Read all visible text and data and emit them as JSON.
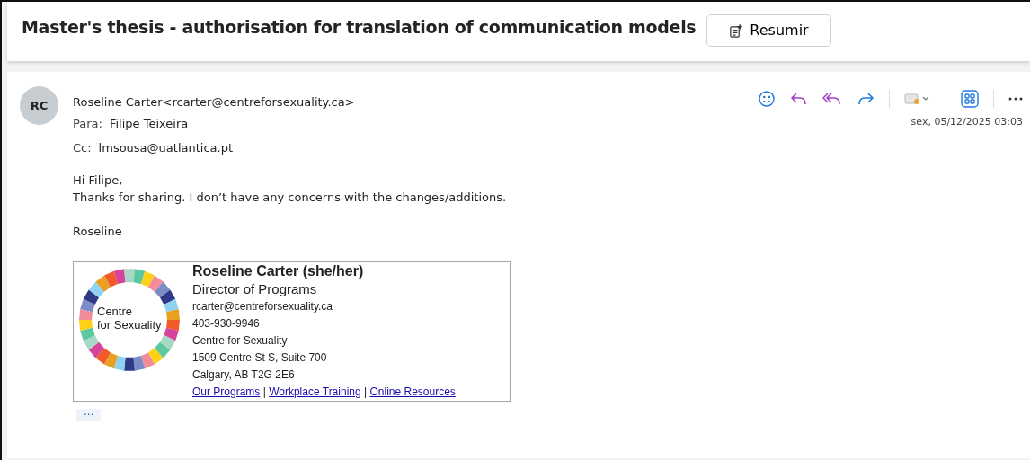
{
  "subject": "Master's thesis - authorisation for translation of communication models",
  "summarize_button": "Resumir",
  "message": {
    "avatar_initials": "RC",
    "from": "Roseline Carter<rcarter@centreforsexuality.ca>",
    "to_label": "Para:",
    "to": "Filipe Teixeira",
    "cc_label": "Cc:",
    "cc": "lmsousa@uatlantica.pt",
    "date": "sex, 05/12/2025 03:03",
    "body": [
      [
        "Hi Filipe,",
        "Thanks for sharing. I don’t have any concerns with the changes/additions."
      ],
      [
        "Roseline"
      ]
    ],
    "more_button": "···"
  },
  "signature": {
    "logo_text": [
      "Centre",
      "for Sexuality"
    ],
    "name": "Roseline Carter (she/her)",
    "title": "Director of Programs",
    "lines": [
      "rcarter@centreforsexuality.ca",
      "403-930-9946",
      "Centre for Sexuality",
      "1509 Centre St S, Suite 700",
      "Calgary, AB T2G 2E6"
    ],
    "links": [
      "Our Programs",
      "Workplace Training",
      "Online Resources"
    ],
    "link_separator": "|"
  }
}
